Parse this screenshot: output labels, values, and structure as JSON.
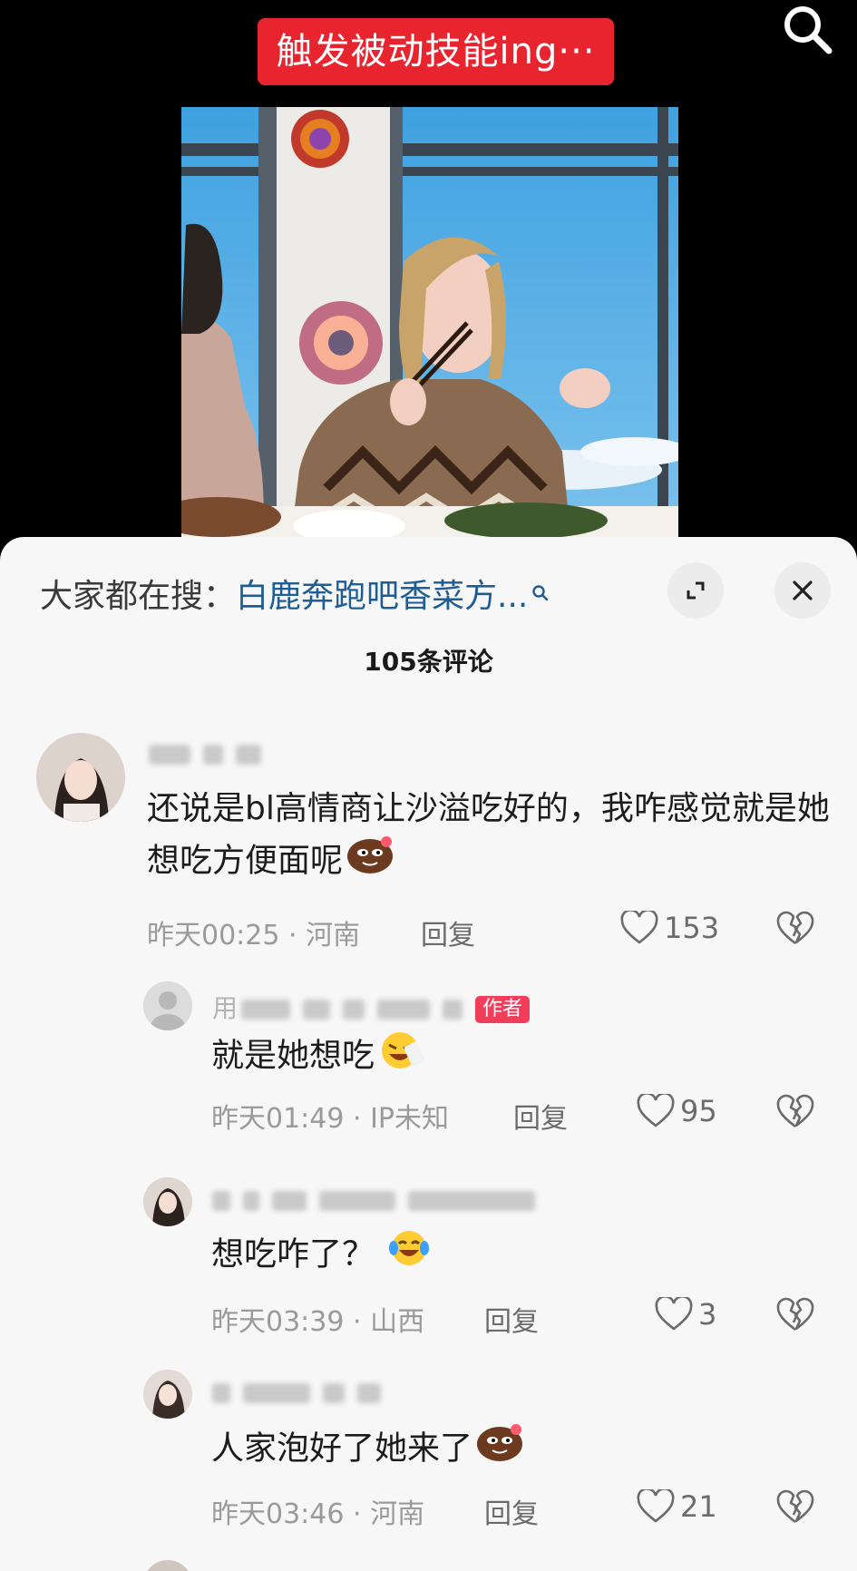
{
  "banner": {
    "text": "触发被动技能ing···"
  },
  "icons": {
    "search": "search-icon",
    "expand": "expand-icon",
    "close": "close-icon",
    "like": "heart-icon",
    "dislike": "broken-heart-icon"
  },
  "colors": {
    "banner_bg": "#e8242f",
    "hint_link": "#1f5e95",
    "author_tag": "#f23d5b"
  },
  "search_hint": {
    "prefix": "大家都在搜：",
    "query": "白鹿奔跑吧香菜方..."
  },
  "comment_count": "105条评论",
  "comments": [
    {
      "text": "还说是bl高情商让沙溢吃好的，我咋感觉就是她想吃方便面呢",
      "time": "昨天00:25",
      "location": "河南",
      "reply_label": "回复",
      "likes": "153"
    },
    {
      "username_prefix": "用",
      "author_tag": "作者",
      "text": "就是她想吃",
      "time": "昨天01:49",
      "location": "IP未知",
      "reply_label": "回复",
      "likes": "95"
    },
    {
      "text": "想吃咋了？",
      "time": "昨天03:39",
      "location": "山西",
      "reply_label": "回复",
      "likes": "3"
    },
    {
      "text": "人家泡好了她来了",
      "time": "昨天03:46",
      "location": "河南",
      "reply_label": "回复",
      "likes": "21"
    }
  ]
}
